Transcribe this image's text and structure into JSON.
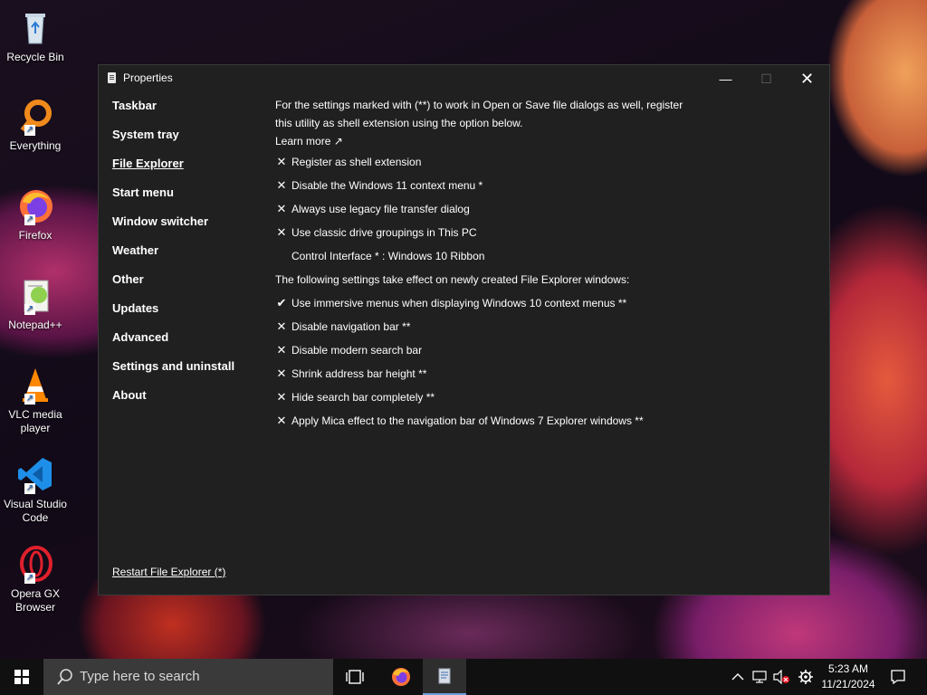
{
  "desktop": {
    "icons": [
      {
        "label": "Recycle Bin",
        "icon": "recycle-bin-icon"
      },
      {
        "label": "Everything",
        "icon": "everything-search-icon"
      },
      {
        "label": "Firefox",
        "icon": "firefox-icon"
      },
      {
        "label": "Notepad++",
        "icon": "notepadpp-icon"
      },
      {
        "label": "VLC media player",
        "icon": "vlc-icon"
      },
      {
        "label": "Visual Studio Code",
        "icon": "vscode-icon"
      },
      {
        "label": "Opera GX Browser",
        "icon": "opera-gx-icon"
      }
    ]
  },
  "window": {
    "title": "Properties",
    "controls": {
      "minimize": "—",
      "maximize": "☐",
      "close": "✕"
    },
    "nav": [
      "Taskbar",
      "System tray",
      "File Explorer",
      "Start menu",
      "Window switcher",
      "Weather",
      "Other",
      "Updates",
      "Advanced",
      "Settings and uninstall",
      "About"
    ],
    "active_nav": "File Explorer",
    "intro_line1": "For the settings marked with (**) to work in Open or Save file dialogs as well, register",
    "intro_line2": "this utility as shell extension using the option below.",
    "learn_more": "Learn more ↗",
    "options_top": [
      {
        "mark": "✕",
        "text": "Register as shell extension"
      },
      {
        "mark": "✕",
        "text": "Disable the Windows 11 context menu *"
      },
      {
        "mark": "✕",
        "text": "Always use legacy file transfer dialog"
      },
      {
        "mark": "✕",
        "text": "Use classic drive groupings in This PC"
      },
      {
        "mark": "",
        "text": "Control Interface * : Windows 10 Ribbon"
      }
    ],
    "section_note": "The following settings take effect on newly created File Explorer windows:",
    "options_bottom": [
      {
        "mark": "✔",
        "text": "Use immersive menus when displaying Windows 10 context menus **"
      },
      {
        "mark": "✕",
        "text": "Disable navigation bar **"
      },
      {
        "mark": "✕",
        "text": "Disable modern search bar"
      },
      {
        "mark": "✕",
        "text": "Shrink address bar height **"
      },
      {
        "mark": "✕",
        "text": "Hide search bar completely **"
      },
      {
        "mark": "✕",
        "text": "Apply Mica effect to the navigation bar of Windows 7 Explorer windows **"
      }
    ],
    "restart_link": "Restart File Explorer (*)"
  },
  "taskbar": {
    "search_placeholder": "Type here to search",
    "clock_time": "5:23 AM",
    "clock_date": "11/21/2024",
    "accent": "#6a9fd8"
  }
}
